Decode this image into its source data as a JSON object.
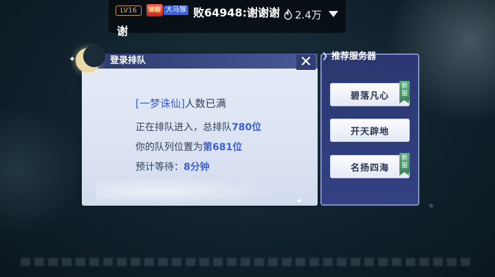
{
  "stream": {
    "level_badge": "LV16",
    "fan_emblem": "锦鲤",
    "fan_name": "大马猴",
    "chat_message": "败64948:谢谢谢谢",
    "popularity": "2.4万",
    "flame_icon": "flame-icon",
    "dropdown_icon": "triangle-down-icon"
  },
  "queue_dialog": {
    "title": "登录排队",
    "close_icon": "close-x-icon",
    "server_bracket_name": "[一梦诛仙]",
    "server_status": "人数已满",
    "line1_prefix": "正在排队进入，总排队",
    "line1_count": "780位",
    "line2_prefix": "你的队列位置为",
    "line2_position": "第681位",
    "line3_prefix": "预计等待：",
    "line3_wait": "8分钟"
  },
  "recommend": {
    "title": "推荐服务器",
    "servers": [
      {
        "name": "碧落凡心",
        "tag": "新服"
      },
      {
        "name": "开天辟地",
        "tag": ""
      },
      {
        "name": "名扬四海",
        "tag": "新服"
      }
    ]
  }
}
